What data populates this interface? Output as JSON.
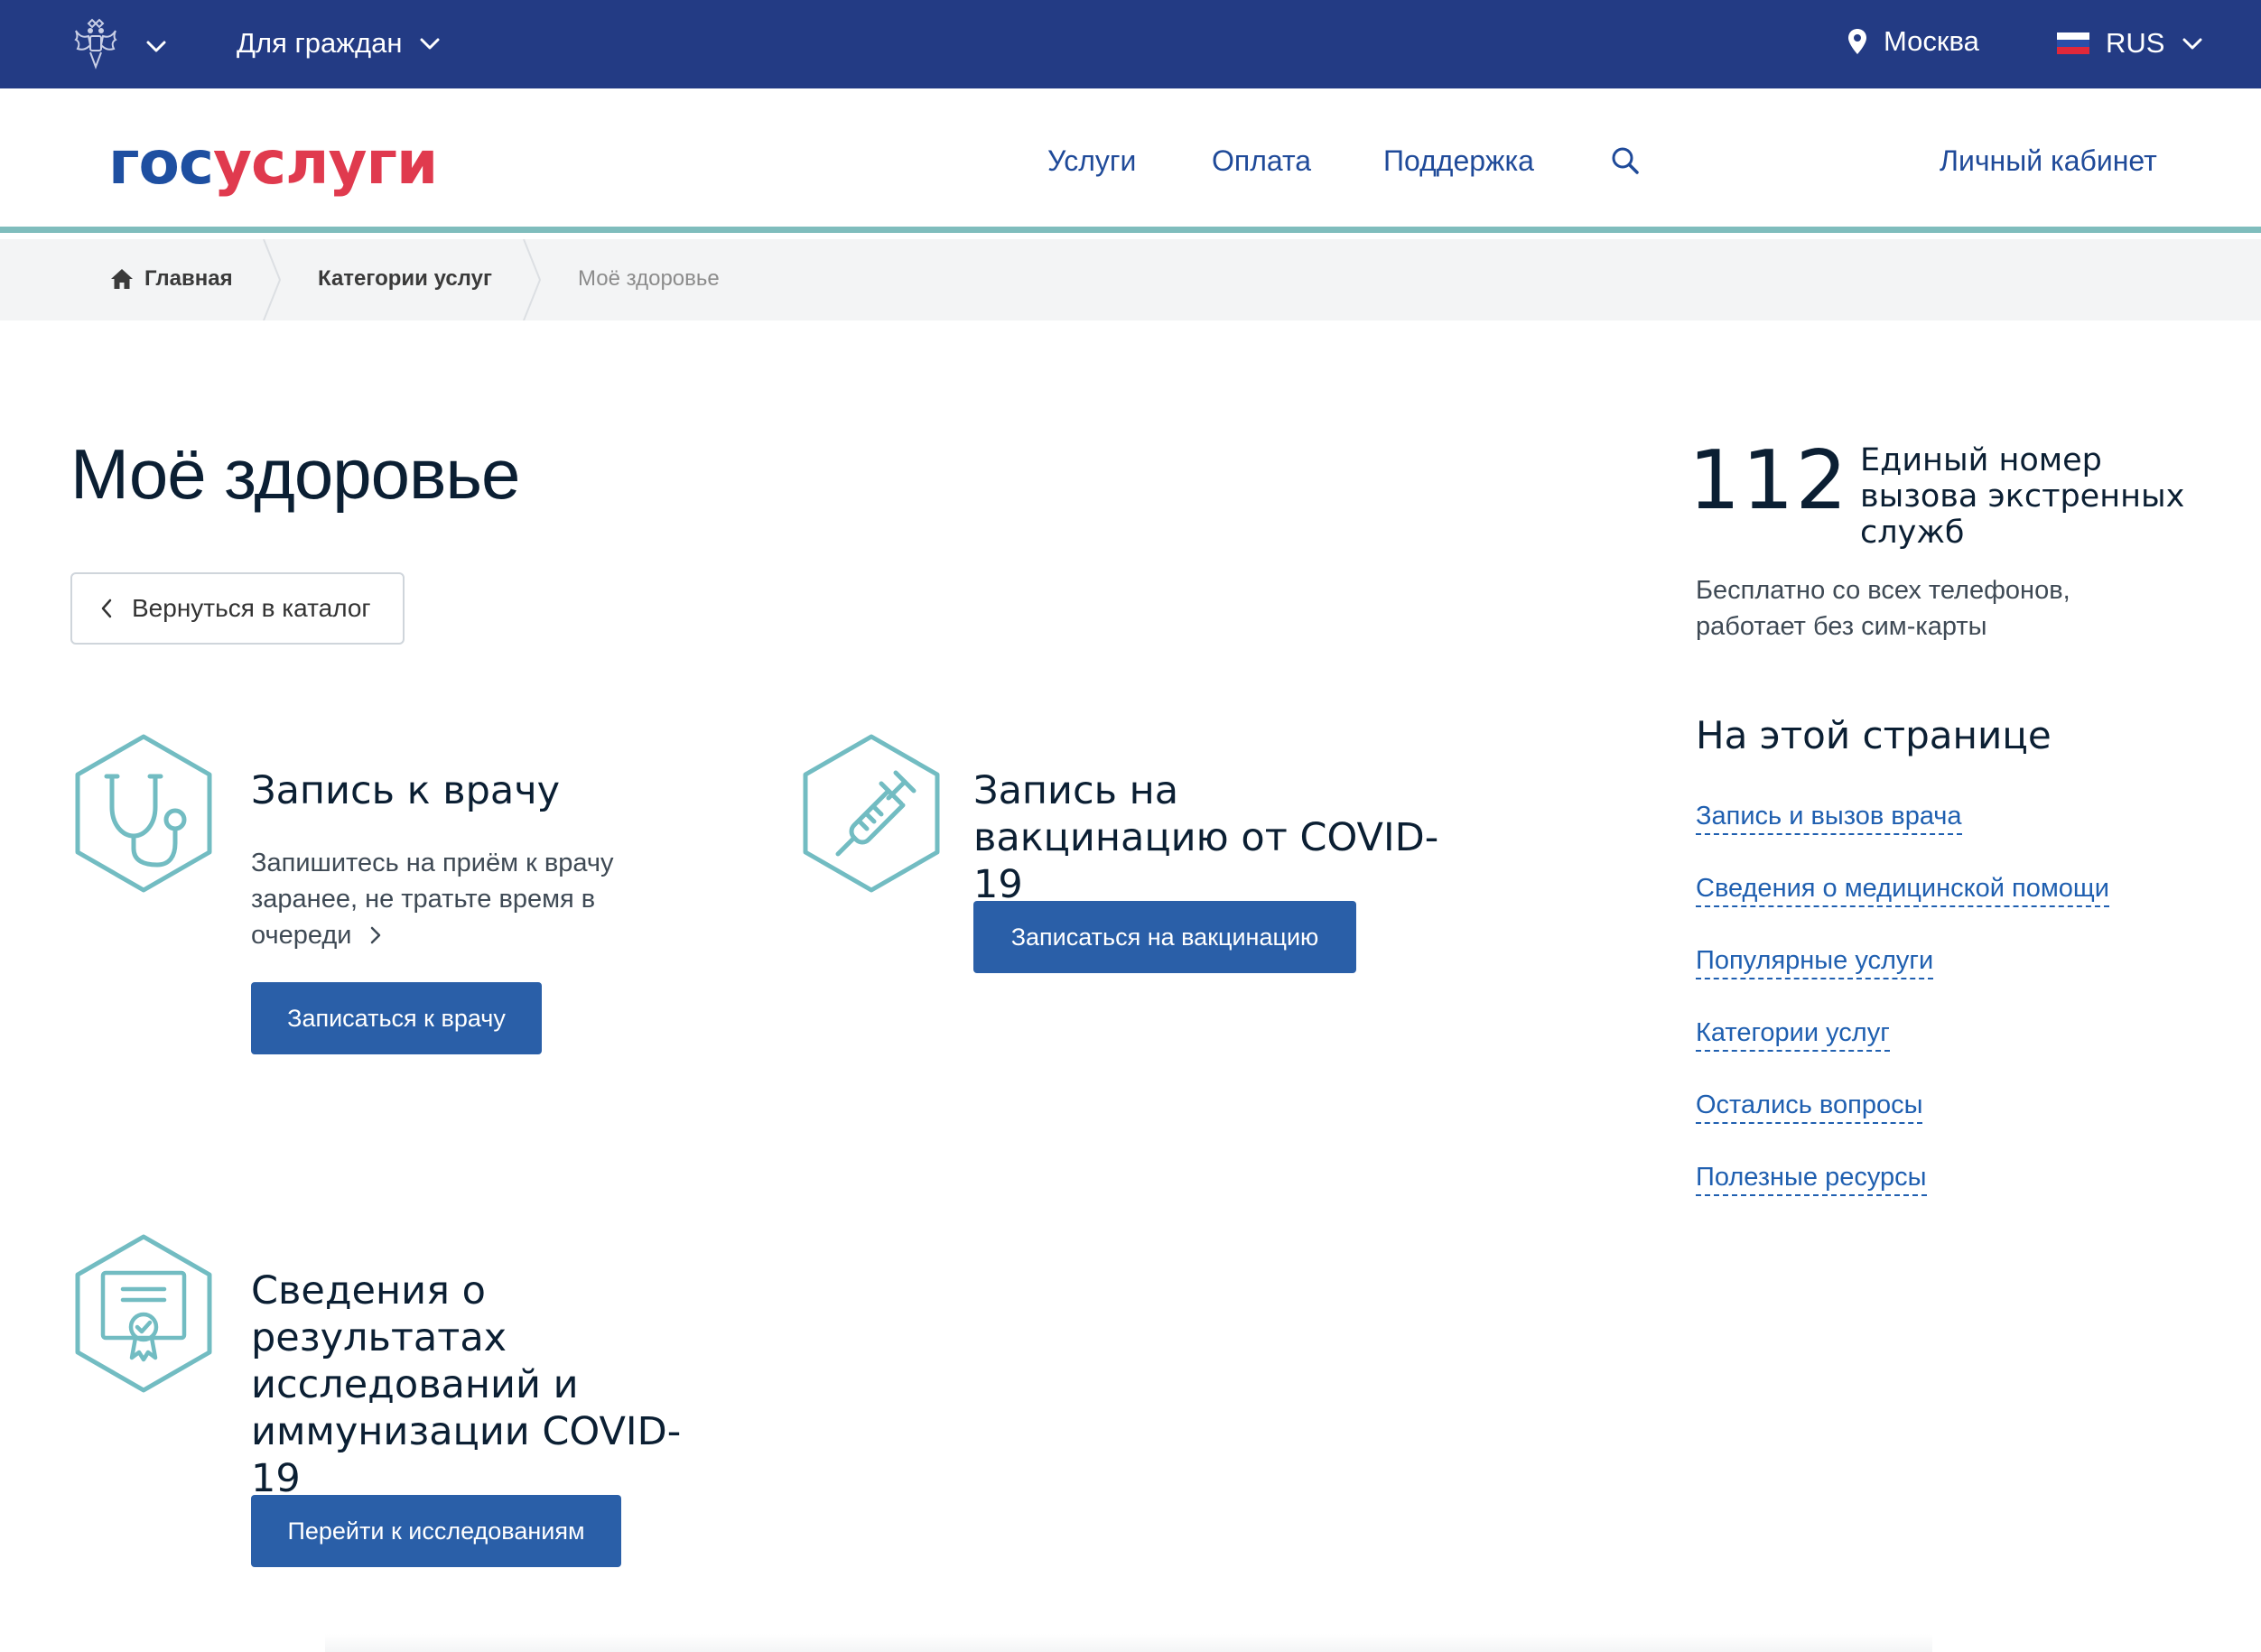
{
  "topbar": {
    "for_citizens": "Для граждан",
    "location": "Москва",
    "language": "RUS",
    "colors": {
      "background": "#233b84"
    }
  },
  "header": {
    "logo": {
      "part1": "гос",
      "part2": "услуги"
    },
    "nav": [
      {
        "label": "Услуги"
      },
      {
        "label": "Оплата"
      },
      {
        "label": "Поддержка"
      }
    ],
    "search_icon": "search-icon",
    "cabinet": "Личный кабинет"
  },
  "breadcrumb": {
    "home": "Главная",
    "categories": "Категории услуг",
    "current": "Моё здоровье"
  },
  "main": {
    "title": "Моё здоровье",
    "back_label": "Вернуться в каталог",
    "services": [
      {
        "icon": "stethoscope-icon",
        "title": "Запись к врачу",
        "description": "Запишитесь на приём к врачу заранее, не тратьте время в очереди",
        "button": "Записаться к врачу"
      },
      {
        "icon": "syringe-icon",
        "title": "Запись на вакцинацию от COVID-19",
        "button": "Записаться на вакцинацию"
      },
      {
        "icon": "certificate-icon",
        "title": "Сведения о результатах исследований и иммунизации COVID-19",
        "button": "Перейти к исследованиям"
      }
    ]
  },
  "aside": {
    "emergency_number": "112",
    "emergency_title": "Единый номер вызова экстренных служб",
    "emergency_note": "Бесплатно со всех телефонов, работает без сим-карты",
    "on_page_title": "На этой странице",
    "links": [
      "Запись и вызов врача",
      "Сведения о медицинской помощи",
      "Популярные услуги",
      "Категории услуг",
      "Остались вопросы",
      "Полезные ресурсы"
    ]
  },
  "colors": {
    "primary_button": "#2a5fa8",
    "link": "#1f5fb0",
    "icon_teal": "#72bcc2",
    "header_rule": "#7fbdbd",
    "logo_blue": "#1e4fa1",
    "logo_red": "#e03a4e"
  }
}
